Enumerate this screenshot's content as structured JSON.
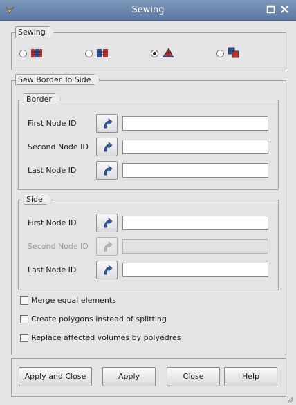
{
  "window": {
    "title": "Sewing"
  },
  "sewing": {
    "label": "Sewing",
    "options": [
      {
        "icon": "sew-free-borders-icon",
        "checked": false
      },
      {
        "icon": "sew-conform-borders-icon",
        "checked": false
      },
      {
        "icon": "sew-border-to-side-icon",
        "checked": true
      },
      {
        "icon": "sew-side-elements-icon",
        "checked": false
      }
    ]
  },
  "sew_border_to_side": {
    "label": "Sew Border To Side",
    "border": {
      "label": "Border",
      "first_node": {
        "label": "First Node ID",
        "value": ""
      },
      "second_node": {
        "label": "Second Node ID",
        "value": ""
      },
      "last_node": {
        "label": "Last Node ID",
        "value": ""
      }
    },
    "side": {
      "label": "Side",
      "first_node": {
        "label": "First Node ID",
        "value": ""
      },
      "second_node": {
        "label": "Second Node ID",
        "value": "",
        "disabled": true
      },
      "last_node": {
        "label": "Last Node ID",
        "value": ""
      }
    },
    "options": {
      "merge_equal": "Merge equal elements",
      "create_polygons": "Create polygons instead of splitting",
      "replace_volumes": "Replace affected volumes by polyedres"
    }
  },
  "buttons": {
    "apply_close": "Apply and Close",
    "apply": "Apply",
    "close": "Close",
    "help": "Help"
  },
  "colors": {
    "title_bar": "#6a86ae",
    "select_arrow": "#2a5ea8"
  }
}
